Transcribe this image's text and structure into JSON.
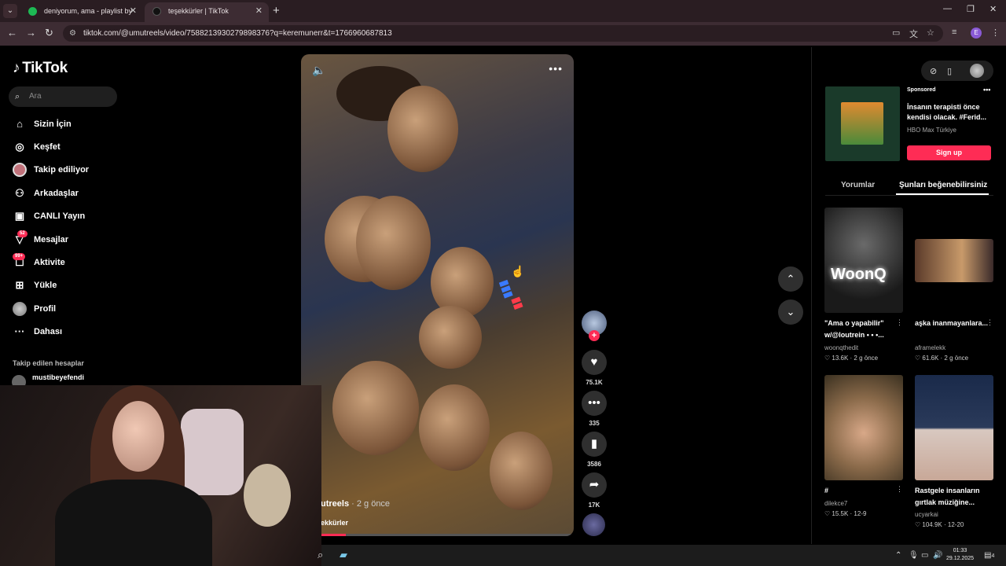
{
  "browser": {
    "tabs": [
      {
        "title": "deniyorum, ama - playlist by",
        "favicon_color": "#1db954",
        "active": false
      },
      {
        "title": "teşekkürler | TikTok",
        "favicon_color": "#000000",
        "active": true
      }
    ],
    "url": "tiktok.com/@umutreels/video/7588213930279898376?q=keremunerr&t=1766960687813"
  },
  "sidebar": {
    "logo": "TikTok",
    "search_placeholder": "Ara",
    "items": [
      {
        "label": "Sizin İçin",
        "icon": "home-icon"
      },
      {
        "label": "Keşfet",
        "icon": "compass-icon"
      },
      {
        "label": "Takip ediliyor",
        "icon": "following-avatar-icon"
      },
      {
        "label": "Arkadaşlar",
        "icon": "friends-icon"
      },
      {
        "label": "CANLI Yayın",
        "icon": "live-icon"
      },
      {
        "label": "Mesajlar",
        "icon": "messages-icon",
        "badge": "52"
      },
      {
        "label": "Aktivite",
        "icon": "activity-icon",
        "badge": "99+"
      },
      {
        "label": "Yükle",
        "icon": "upload-icon"
      },
      {
        "label": "Profil",
        "icon": "profile-avatar-icon"
      },
      {
        "label": "Dahası",
        "icon": "more-icon"
      }
    ],
    "followed_title": "Takip edilen hesaplar",
    "followed_user": "mustibeyefendi"
  },
  "video": {
    "author": "utreels",
    "time": " · 2 g önce",
    "caption": "ekkürler",
    "progress": 0.1
  },
  "actions": {
    "likes": "75.1K",
    "comments": "335",
    "saves": "3586",
    "shares": "17K"
  },
  "ad": {
    "sponsored": "Sponsored",
    "title": "İnsanın terapisti önce kendisi olacak. #Ferid...",
    "brand": "HBO Max Türkiye",
    "cta": "Sign up"
  },
  "right_tabs": {
    "comments": "Yorumlar",
    "you_may_like": "Şunları beğenebilirsiniz"
  },
  "recommendations": [
    {
      "title": "\"Ama o yapabilir\" w/@loutrein • • •...",
      "author": "woonqthedit",
      "likes": "13.6K",
      "time": "2 g önce",
      "thumb_text": "WoonQ"
    },
    {
      "title": "aşka inanmayanlara...",
      "author": "aframelekk",
      "likes": "61.6K",
      "time": "2 g önce"
    },
    {
      "title": "#",
      "author": "dilekce7",
      "likes": "15.5K",
      "time": "12-9"
    },
    {
      "title": "Rastgele insanların gırtlak müziğine...",
      "author": "ucyarkai",
      "likes": "104.9K",
      "time": "12-20"
    }
  ],
  "taskbar": {
    "time": "01:33",
    "date": "29.12.2025",
    "notifications": "4"
  }
}
